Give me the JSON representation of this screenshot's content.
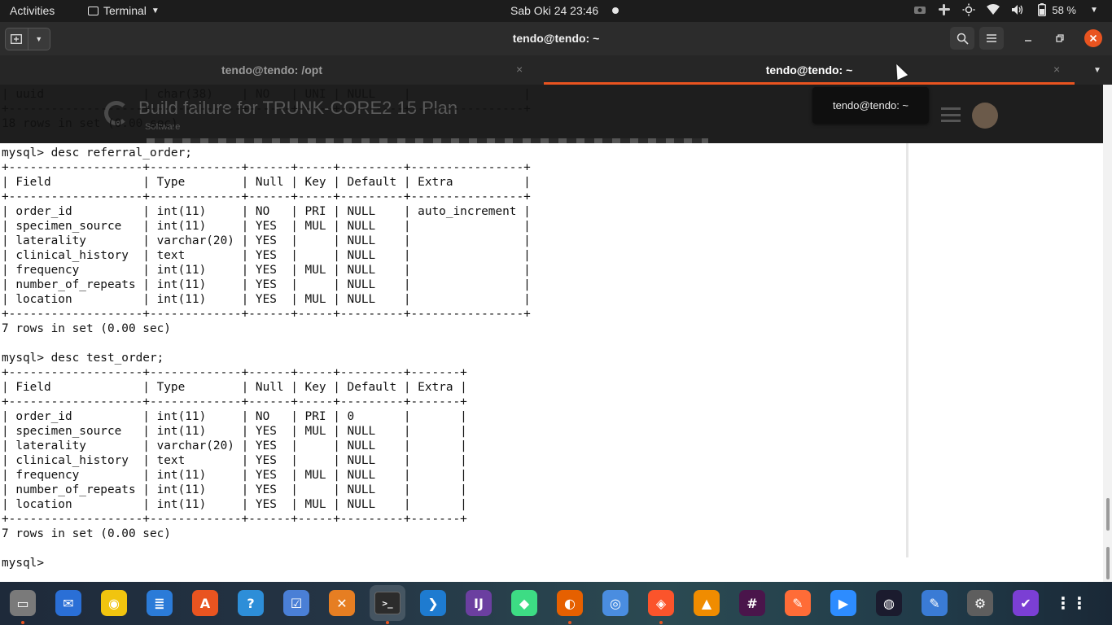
{
  "topbar": {
    "activities": "Activities",
    "app_name": "Terminal",
    "clock": "Sab Oki 24  23:46",
    "battery": "58 %"
  },
  "window": {
    "title": "tendo@tendo: ~"
  },
  "tabs": [
    {
      "label": "tendo@tendo: /opt",
      "close": "×"
    },
    {
      "label": "tendo@tendo: ~",
      "close": "×"
    }
  ],
  "tooltip": "tendo@tendo: ~",
  "background_window": {
    "title": "Build failure for TRUNK-CORE2 15 Plan",
    "subtitle": "Software"
  },
  "terminal": {
    "lines": [
      "| uuid              | char(38)    | NO   | UNI | NULL    |                |",
      "+-------------------+-------------+------+-----+---------+----------------+",
      "18 rows in set (0.00 sec)",
      "",
      "mysql> desc referral_order;",
      "+-------------------+-------------+------+-----+---------+----------------+",
      "| Field             | Type        | Null | Key | Default | Extra          |",
      "+-------------------+-------------+------+-----+---------+----------------+",
      "| order_id          | int(11)     | NO   | PRI | NULL    | auto_increment |",
      "| specimen_source   | int(11)     | YES  | MUL | NULL    |                |",
      "| laterality        | varchar(20) | YES  |     | NULL    |                |",
      "| clinical_history  | text        | YES  |     | NULL    |                |",
      "| frequency         | int(11)     | YES  | MUL | NULL    |                |",
      "| number_of_repeats | int(11)     | YES  |     | NULL    |                |",
      "| location          | int(11)     | YES  | MUL | NULL    |                |",
      "+-------------------+-------------+------+-----+---------+----------------+",
      "7 rows in set (0.00 sec)",
      "",
      "mysql> desc test_order;",
      "+-------------------+-------------+------+-----+---------+-------+",
      "| Field             | Type        | Null | Key | Default | Extra |",
      "+-------------------+-------------+------+-----+---------+-------+",
      "| order_id          | int(11)     | NO   | PRI | 0       |       |",
      "| specimen_source   | int(11)     | YES  | MUL | NULL    |       |",
      "| laterality        | varchar(20) | YES  |     | NULL    |       |",
      "| clinical_history  | text        | YES  |     | NULL    |       |",
      "| frequency         | int(11)     | YES  | MUL | NULL    |       |",
      "| number_of_repeats | int(11)     | YES  |     | NULL    |       |",
      "| location          | int(11)     | YES  | MUL | NULL    |       |",
      "+-------------------+-------------+------+-----+---------+-------+",
      "7 rows in set (0.00 sec)",
      "",
      "mysql> "
    ]
  },
  "dock": [
    {
      "name": "files-icon",
      "color": "#7a7a7a",
      "glyph": "▭"
    },
    {
      "name": "thunderbird-icon",
      "color": "#2a6fd6",
      "glyph": "✉"
    },
    {
      "name": "rhythmbox-icon",
      "color": "#f1c40f",
      "glyph": "◉"
    },
    {
      "name": "libreoffice-writer-icon",
      "color": "#2b7bd8",
      "glyph": "≣"
    },
    {
      "name": "software-center-icon",
      "color": "#e95420",
      "glyph": "A"
    },
    {
      "name": "help-icon",
      "color": "#2d8ed8",
      "glyph": "?"
    },
    {
      "name": "tasks-icon",
      "color": "#4a7fd6",
      "glyph": "☑"
    },
    {
      "name": "crossover-icon",
      "color": "#e67e22",
      "glyph": "✕"
    },
    {
      "name": "terminal-icon",
      "color": "#2c2c2c",
      "glyph": ">_"
    },
    {
      "name": "vscode-icon",
      "color": "#1e7bd0",
      "glyph": "❯"
    },
    {
      "name": "intellij-icon",
      "color": "#6b3fa0",
      "glyph": "IJ"
    },
    {
      "name": "android-studio-icon",
      "color": "#3ddc84",
      "glyph": "◆"
    },
    {
      "name": "firefox-icon",
      "color": "#e66000",
      "glyph": "◐"
    },
    {
      "name": "chromium-icon",
      "color": "#4a8de0",
      "glyph": "◎"
    },
    {
      "name": "brave-icon",
      "color": "#fb542b",
      "glyph": "◈"
    },
    {
      "name": "vlc-icon",
      "color": "#f08c00",
      "glyph": "▲"
    },
    {
      "name": "slack-icon",
      "color": "#4a154b",
      "glyph": "#"
    },
    {
      "name": "postman-icon",
      "color": "#ff6c37",
      "glyph": "✎"
    },
    {
      "name": "zoom-icon",
      "color": "#2d8cff",
      "glyph": "▶"
    },
    {
      "name": "screen-recorder-icon",
      "color": "#1b1b2e",
      "glyph": "◍"
    },
    {
      "name": "text-editor-icon",
      "color": "#3a7bd5",
      "glyph": "✎"
    },
    {
      "name": "settings-icon",
      "color": "#5e5e5e",
      "glyph": "⚙"
    },
    {
      "name": "todo-icon",
      "color": "#7b3fd4",
      "glyph": "✔"
    },
    {
      "name": "show-apps-icon",
      "color": "transparent",
      "glyph": "⋮⋮"
    }
  ]
}
